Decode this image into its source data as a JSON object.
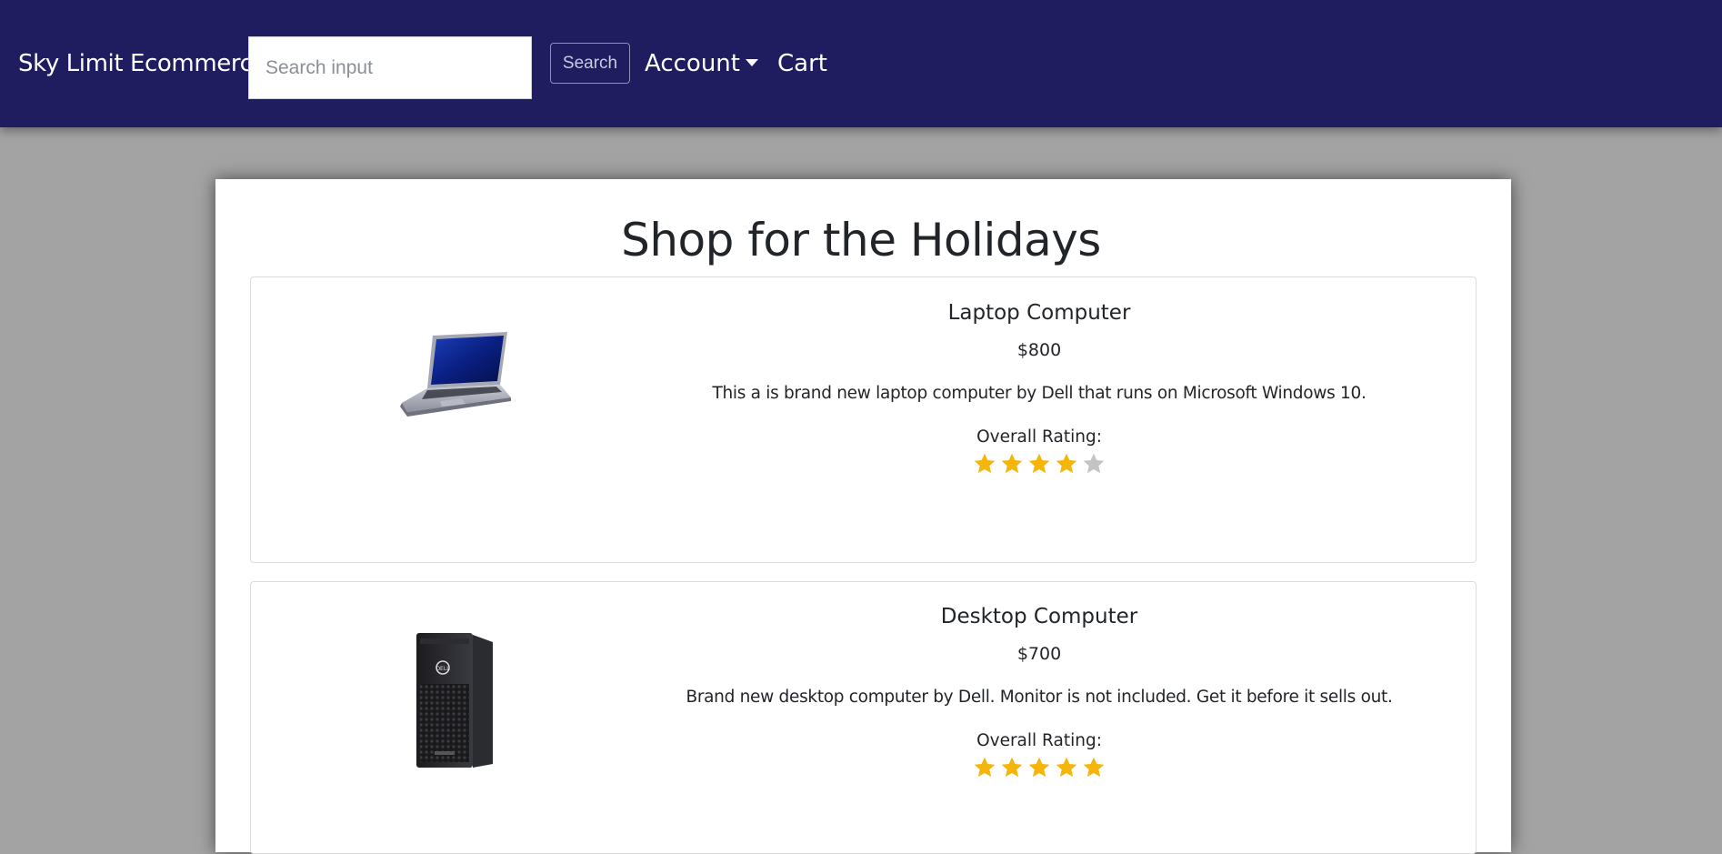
{
  "navbar": {
    "brand": "Sky Limit Ecommerce",
    "search_placeholder": "Search input",
    "search_value": "",
    "search_button": "Search",
    "account_label": "Account",
    "cart_label": "Cart",
    "background_color": "#1f1c60"
  },
  "page": {
    "title": "Shop for the Holidays",
    "background_color": "#a3a3a3"
  },
  "products": [
    {
      "name": "Laptop Computer",
      "price": "$800",
      "description": "This a is brand new laptop computer by Dell that runs on Microsoft Windows 10.",
      "rating_label": "Overall Rating:",
      "rating": 4,
      "rating_max": 5,
      "image_icon": "laptop-icon"
    },
    {
      "name": "Desktop Computer",
      "price": "$700",
      "description": "Brand new desktop computer by Dell. Monitor is not included. Get it before it sells out.",
      "rating_label": "Overall Rating:",
      "rating": 5,
      "rating_max": 5,
      "image_icon": "desktop-tower-icon"
    }
  ],
  "colors": {
    "star_filled": "#f5b50a",
    "star_empty": "#c4c4c4"
  }
}
